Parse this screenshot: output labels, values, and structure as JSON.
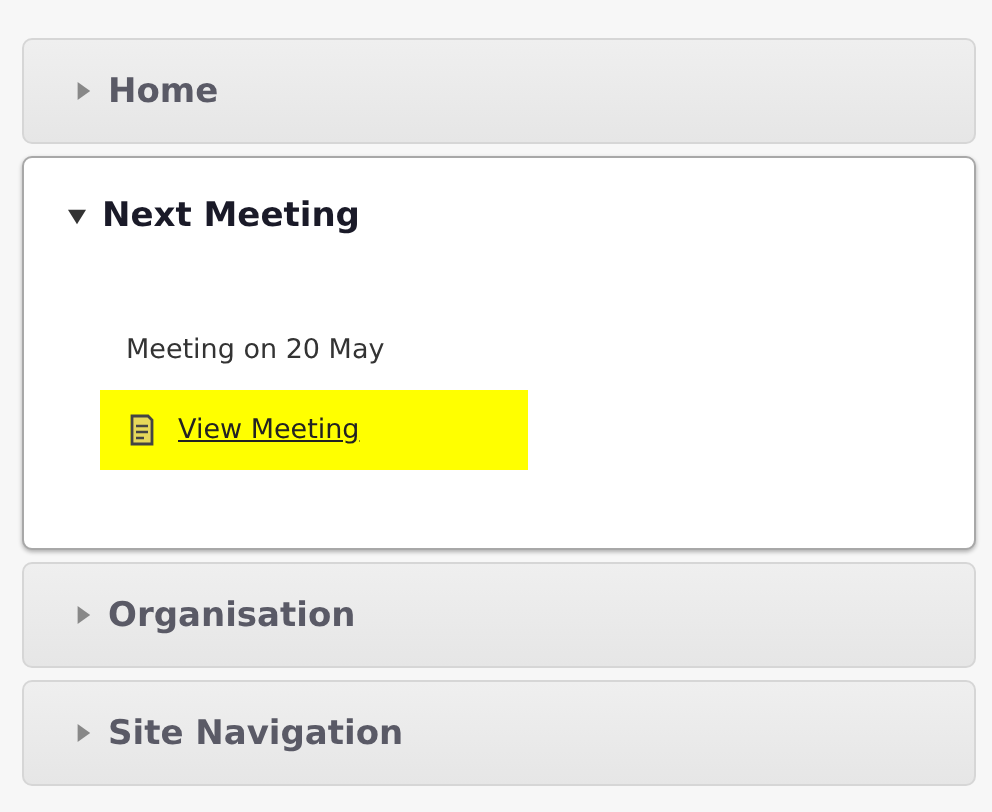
{
  "sections": [
    {
      "title": "Home",
      "expanded": false
    },
    {
      "title": "Next Meeting",
      "expanded": true,
      "content": {
        "text": "Meeting on 20 May",
        "link": "View Meeting"
      }
    },
    {
      "title": "Organisation",
      "expanded": false
    },
    {
      "title": "Site Navigation",
      "expanded": false
    }
  ]
}
